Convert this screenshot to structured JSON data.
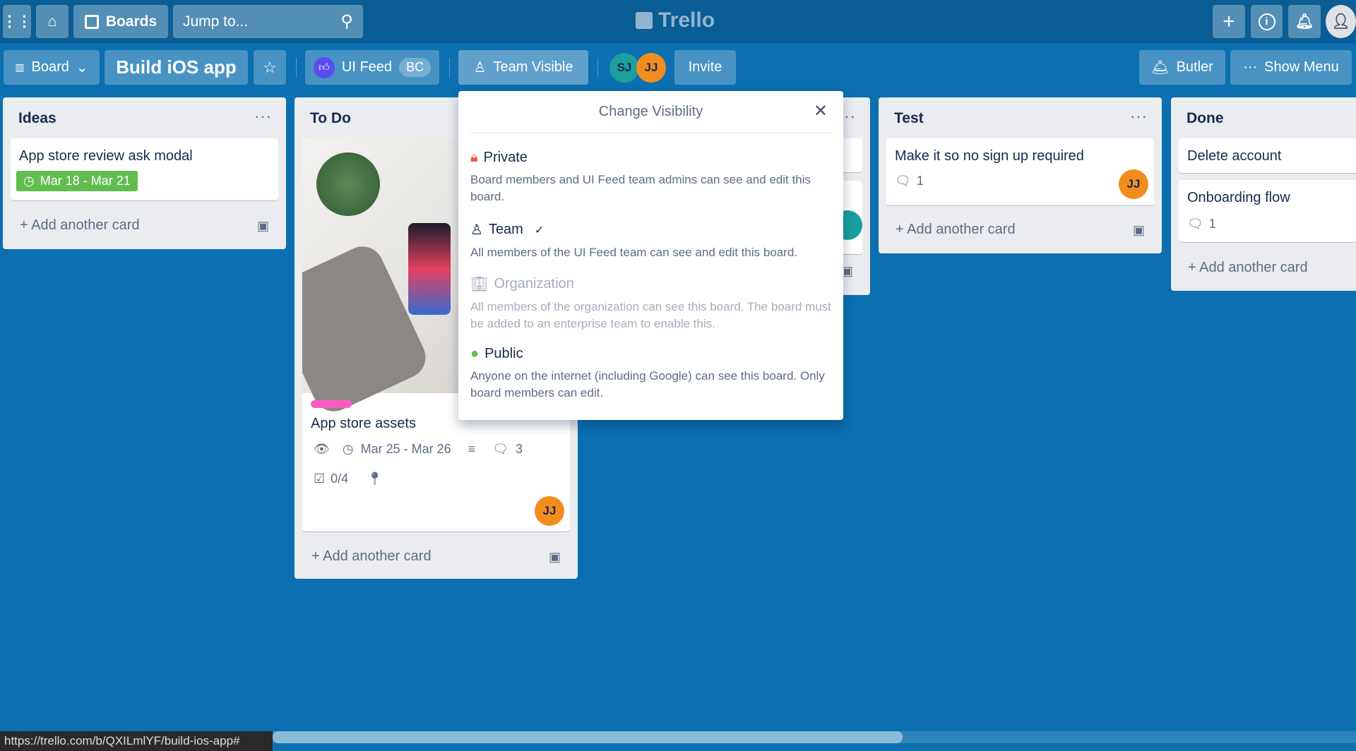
{
  "topbar": {
    "boards_label": "Boards",
    "search_placeholder": "Jump to...",
    "logo": "Trello",
    "profile_icon": "user-icon"
  },
  "board_header": {
    "view_label": "Board",
    "title": "Build iOS app",
    "team_name": "UI Feed",
    "team_badge": "BC",
    "visibility_label": "Team Visible",
    "members": [
      {
        "initials": "SJ",
        "color": "#1a9e9e"
      },
      {
        "initials": "JJ",
        "color": "#f28c1f"
      }
    ],
    "invite_label": "Invite",
    "butler_label": "Butler",
    "show_menu_label": "Show Menu"
  },
  "lists": [
    {
      "title": "Ideas",
      "cards": [
        {
          "title": "App store review ask modal",
          "due": "Mar 18 - Mar 21",
          "due_color": "#61bd4f"
        }
      ],
      "add_label": "Add another card"
    },
    {
      "title": "To Do",
      "cards": [
        {
          "title": "App store assets",
          "label_color": "#ff5bc4",
          "due": "Mar 25 - Mar 26",
          "comments": "3",
          "checklist": "0/4",
          "member": "JJ"
        }
      ],
      "add_label": "Add another card"
    },
    {
      "title": "",
      "cards": []
    },
    {
      "title": "Test",
      "cards": [
        {
          "title": "Make it so no sign up required",
          "comments": "1",
          "member": "JJ"
        }
      ],
      "add_label": "Add another card"
    },
    {
      "title": "Done",
      "cards": [
        {
          "title": "Delete account"
        },
        {
          "title": "Onboarding flow",
          "comments": "1"
        }
      ],
      "add_label": "Add another card"
    }
  ],
  "visibility_popup": {
    "title": "Change Visibility",
    "options": [
      {
        "name": "Private",
        "desc": "Board members and UI Feed team admins can see and edit this board.",
        "icon_color": "#eb5a46"
      },
      {
        "name": "Team",
        "desc": "All members of the UI Feed team can see and edit this board.",
        "selected": true
      },
      {
        "name": "Organization",
        "desc": "All members of the organization can see this board. The board must be added to an enterprise team to enable this.",
        "disabled": true
      },
      {
        "name": "Public",
        "desc": "Anyone on the internet (including Google) can see this board. Only board members can edit.",
        "icon_color": "#61bd4f"
      }
    ]
  },
  "status_url": "https://trello.com/b/QXILmlYF/build-ios-app#"
}
